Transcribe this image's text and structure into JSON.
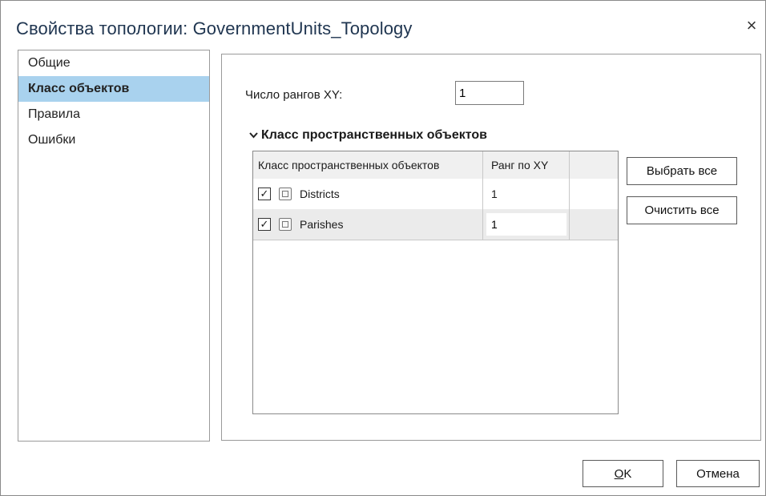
{
  "window": {
    "title": "Свойства топологии: GovernmentUnits_Topology",
    "close_glyph": "×"
  },
  "nav": {
    "items": [
      {
        "label": "Общие",
        "selected": false
      },
      {
        "label": "Класс объектов",
        "selected": true
      },
      {
        "label": "Правила",
        "selected": false
      },
      {
        "label": "Ошибки",
        "selected": false
      }
    ]
  },
  "content": {
    "xy_ranks_label": "Число рангов XY:",
    "xy_ranks_value": "1",
    "section_title": "Класс пространственных объектов",
    "table": {
      "headers": [
        "Класс пространственных объектов",
        "Ранг по XY",
        ""
      ],
      "rows": [
        {
          "checked": true,
          "icon": "feature-class-icon",
          "name": "Districts",
          "rank": "1"
        },
        {
          "checked": true,
          "icon": "feature-class-icon",
          "name": "Parishes",
          "rank": "1"
        }
      ]
    },
    "select_all_label": "Выбрать все",
    "clear_all_label": "Очистить все"
  },
  "footer": {
    "ok_label": "OK",
    "ok_accel": "O",
    "ok_rest": "K",
    "cancel_label": "Отмена"
  },
  "colors": {
    "selected_nav_bg": "#a9d2ee",
    "title_color": "#1f3550"
  }
}
